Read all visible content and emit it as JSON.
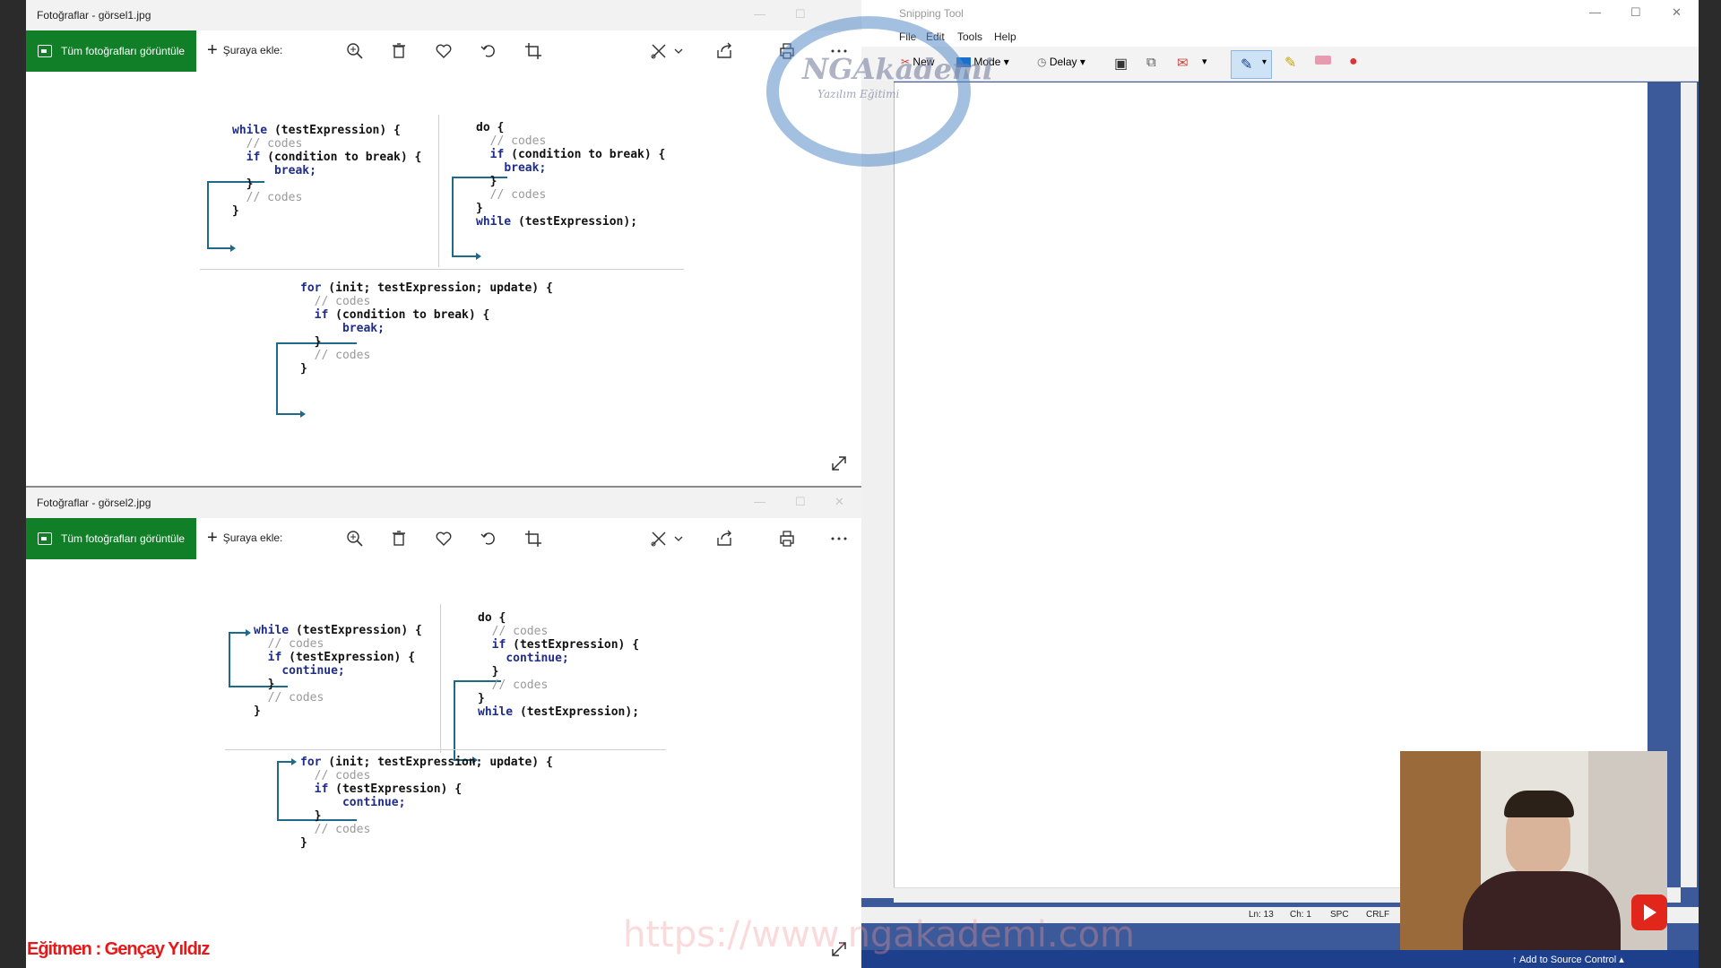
{
  "window1": {
    "title": "Fotoğraflar - görsel1.jpg",
    "view_all": "Tüm fotoğrafları görüntüle",
    "add_to": "Şuraya ekle:",
    "code_while": {
      "l1a": "while",
      "l1b": " (testExpression) {",
      "l2": "// codes",
      "l3a": "if",
      "l3b": " (condition to break) {",
      "l4": "break;",
      "l5": "}",
      "l6": "// codes",
      "l7": "}"
    },
    "code_do": {
      "l1": "do {",
      "l2": "// codes",
      "l3a": "if",
      "l3b": " (condition to break) {",
      "l4": "break;",
      "l5": "}",
      "l6": "// codes",
      "l7": "}",
      "l8a": "while",
      "l8b": " (testExpression);"
    },
    "code_for": {
      "l1a": "for",
      "l1b": " (init; testExpression; update) {",
      "l2": "// codes",
      "l3a": "if",
      "l3b": " (condition to break) {",
      "l4": "break;",
      "l5": "}",
      "l6": "// codes",
      "l7": "}"
    }
  },
  "window2": {
    "title": "Fotoğraflar - görsel2.jpg",
    "view_all": "Tüm fotoğrafları görüntüle",
    "add_to": "Şuraya ekle:",
    "code_while": {
      "l1a": "while",
      "l1b": " (testExpression) {",
      "l2": "// codes",
      "l3a": "if",
      "l3b": " (testExpression) {",
      "l4": "continue;",
      "l5": "}",
      "l6": "// codes",
      "l7": "}"
    },
    "code_do": {
      "l1": "do {",
      "l2": "// codes",
      "l3a": "if",
      "l3b": " (testExpression) {",
      "l4": "continue;",
      "l5": "}",
      "l6": "// codes",
      "l7": "}",
      "l8a": "while",
      "l8b": " (testExpression);"
    },
    "code_for": {
      "l1a": "for",
      "l1b": " (init; testExpression; update) {",
      "l2": "// codes",
      "l3a": "if",
      "l3b": " (testExpression) {",
      "l4": "continue;",
      "l5": "}",
      "l6": "// codes",
      "l7": "}"
    }
  },
  "snipping": {
    "title": "Snipping Tool",
    "menu": [
      "File",
      "Edit",
      "Tools",
      "Help"
    ],
    "toolbar": {
      "new": "New",
      "mode": "Mode",
      "delay": "Delay"
    },
    "status": {
      "ln": "Ln: 13",
      "ch": "Ch: 1",
      "spc": "SPC",
      "crlf": "CRLF"
    },
    "taskbar": "Add to Source Control"
  },
  "watermark": {
    "logo": "NGAkademi",
    "sub": "Yazılım Eğitimi",
    "url": "https://www.ngakademi.com"
  },
  "instructor": "Eğitmen : Gençay Yıldız",
  "colors": {
    "green": "#117e28",
    "keyword": "#1f2d8a",
    "arrow": "#1d6a8a",
    "snip_bg": "#3c5a99"
  }
}
